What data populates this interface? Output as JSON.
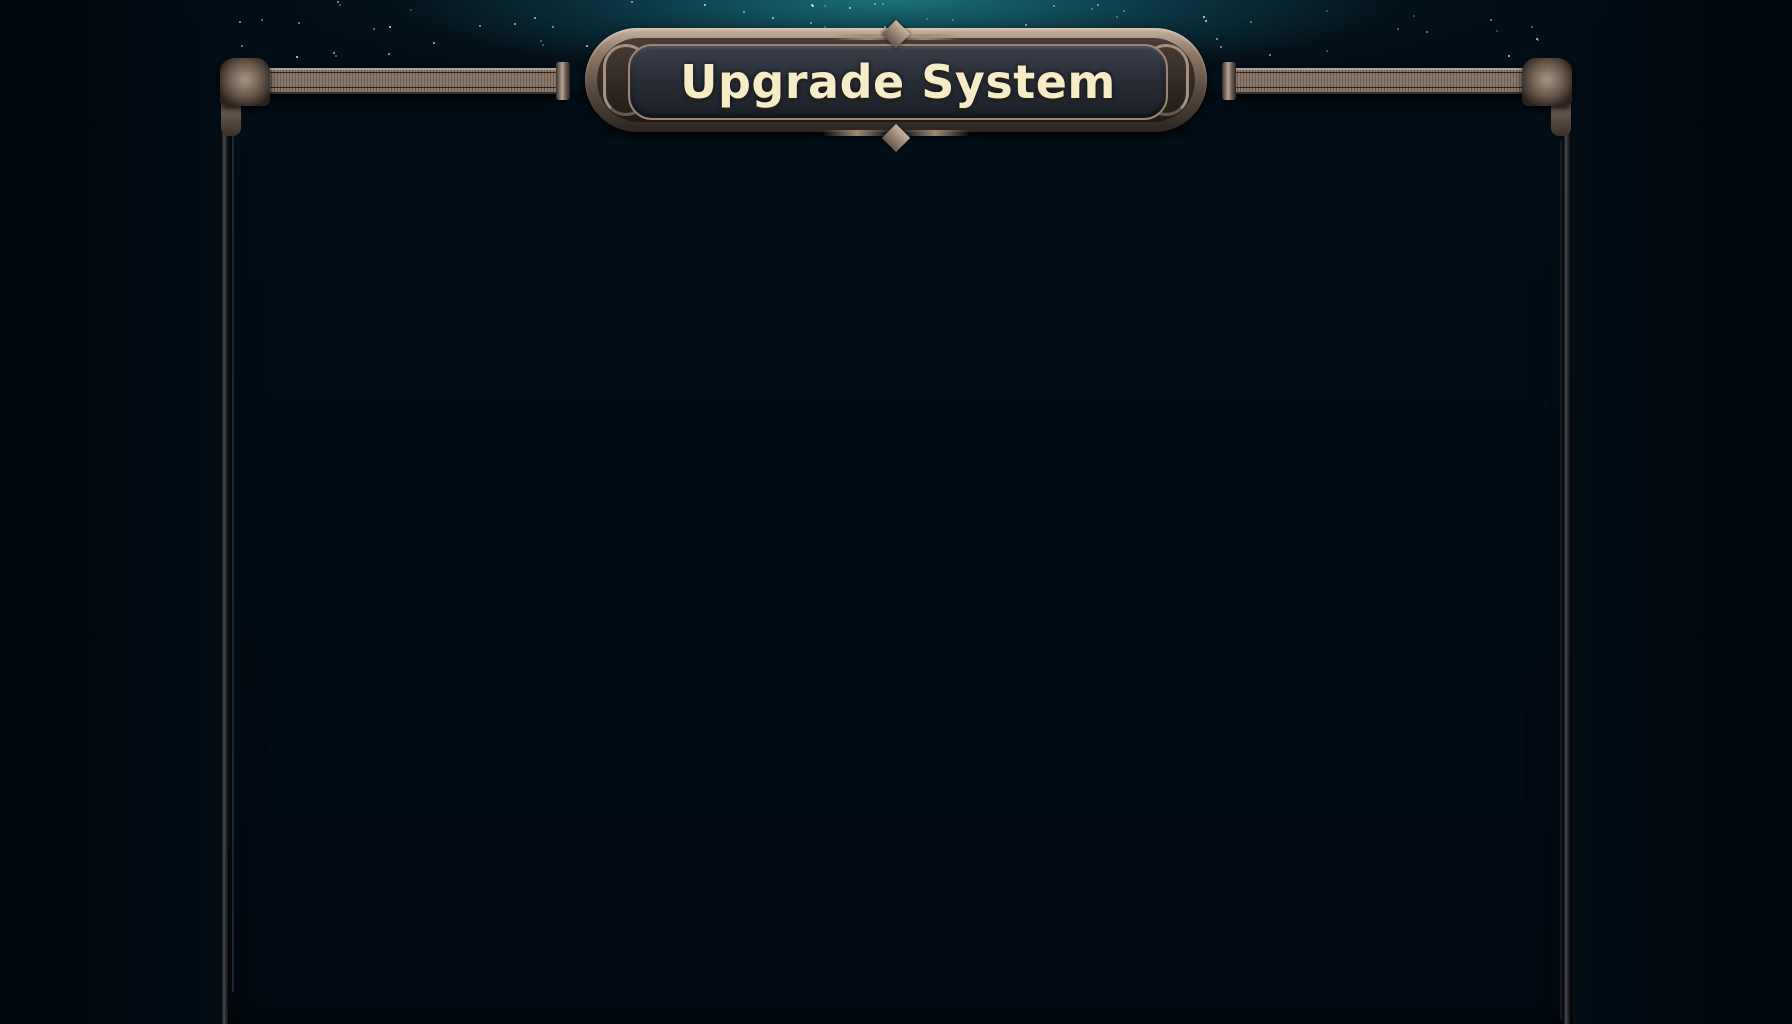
{
  "window": {
    "title": "Upgrade System"
  },
  "colors": {
    "background": "#020b13",
    "sky_glow": "#1c7682",
    "frame_metal": "#8d7767",
    "plaque": "#2a2e38",
    "title_text": "#f6ecc8"
  },
  "icons": {
    "top_left_corner": "ornament-icon",
    "top_right_corner": "ornament-icon",
    "crest_top": "crest-icon",
    "crest_bottom": "crest-icon"
  }
}
